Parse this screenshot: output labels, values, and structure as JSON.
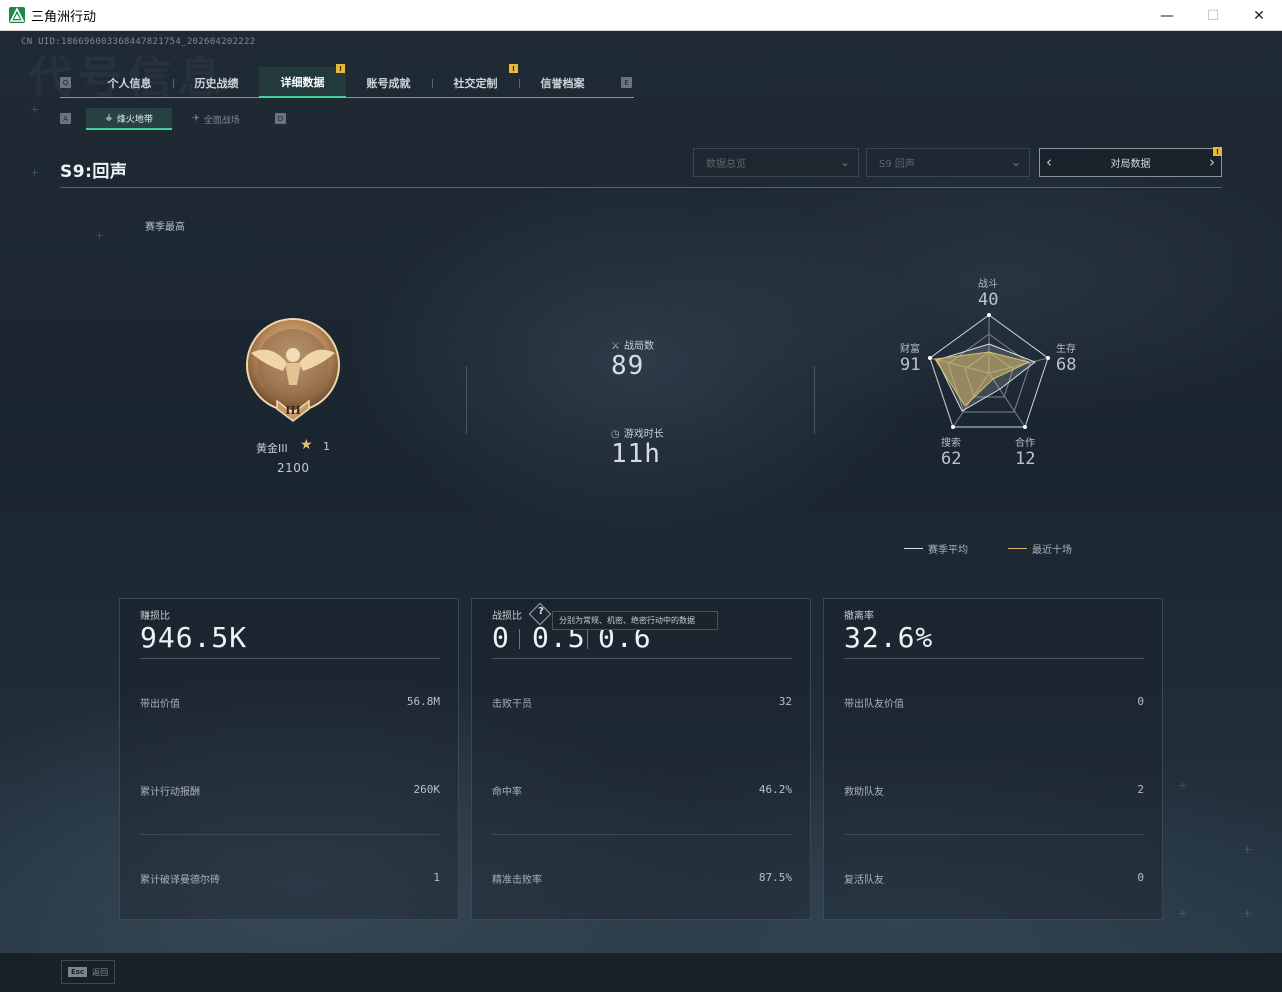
{
  "window": {
    "title": "三角洲行动",
    "controls": [
      "—",
      "☐",
      "✕"
    ]
  },
  "header": {
    "uid": "CN UID:18669600336844782​1754_202604202222",
    "bg_text": "代号信息"
  },
  "tabs": {
    "left_key": "Q",
    "right_key": "E",
    "items": [
      {
        "label": "个人信息"
      },
      {
        "label": "历史战绩"
      },
      {
        "label": "详细数据"
      },
      {
        "label": "账号成就"
      },
      {
        "label": "社交定制"
      },
      {
        "label": "信誉档案"
      }
    ],
    "active": "详细数据",
    "badge": "!"
  },
  "subtabs": {
    "left_key": "A",
    "right_key": "D",
    "items": [
      {
        "label": "烽火地带",
        "glyph": "⚶"
      },
      {
        "label": "全面战场",
        "glyph": "✈"
      }
    ]
  },
  "season": {
    "title": "S9:回声",
    "filter_1": "数据总览",
    "filter_2": "S9 回声",
    "match_data_label": "对局数据",
    "badge": "!"
  },
  "rank": {
    "section_label": "赛季最高",
    "name": "黄金III",
    "stars": "1",
    "score": "2100",
    "medal_numeral": "III"
  },
  "summary": {
    "matches_label": "战局数",
    "matches_value": "89",
    "playtime_label": "游戏时长",
    "playtime_value": "11h"
  },
  "radar": {
    "axes": [
      {
        "label": "战斗",
        "value": "40"
      },
      {
        "label": "生存",
        "value": "68"
      },
      {
        "label": "合作",
        "value": "12"
      },
      {
        "label": "搜索",
        "value": "62"
      },
      {
        "label": "财富",
        "value": "91"
      }
    ],
    "legend_avg": "赛季平均",
    "legend_recent": "最近十场",
    "colors": {
      "avg": "#d9dee2",
      "recent": "#d8bc6a"
    }
  },
  "cards": [
    {
      "title": "赚损比",
      "big": "946.5K",
      "rows": [
        {
          "label": "带出价值",
          "value": "56.8M"
        },
        {
          "label": "累计行动报酬",
          "value": "260K"
        },
        {
          "label": "累计破译曼德尔砖",
          "value": "1"
        }
      ]
    },
    {
      "title": "战损比",
      "ratios": [
        "0",
        "0.5",
        "0.6"
      ],
      "tooltip": "分别为常规、机密、绝密行动中的数据",
      "rows": [
        {
          "label": "击败干员",
          "value": "32"
        },
        {
          "label": "命中率",
          "value": "46.2%"
        },
        {
          "label": "精准击败率",
          "value": "87.5%"
        }
      ]
    },
    {
      "title": "撤离率",
      "big": "32.6%",
      "rows": [
        {
          "label": "带出队友价值",
          "value": "0"
        },
        {
          "label": "救助队友",
          "value": "2"
        },
        {
          "label": "复活队友",
          "value": "0"
        }
      ]
    }
  ],
  "footer": {
    "esc_key": "Esc",
    "esc_label": "返回"
  }
}
